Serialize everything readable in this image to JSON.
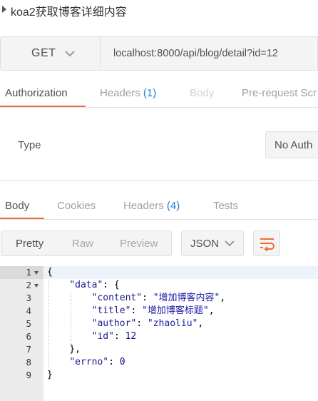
{
  "request_title": "koa2获取博客详细内容",
  "request": {
    "method": "GET",
    "url": "localhost:8000/api/blog/detail?id=12"
  },
  "request_tabs": [
    {
      "label": "Authorization",
      "count": "",
      "state": "active"
    },
    {
      "label": "Headers",
      "count": "(1)",
      "state": "normal"
    },
    {
      "label": "Body",
      "count": "",
      "state": "disabled"
    },
    {
      "label": "Pre-request Scr",
      "count": "",
      "state": "normal"
    }
  ],
  "auth": {
    "type_label": "Type",
    "type_value": "No Auth"
  },
  "response_tabs": [
    {
      "label": "Body",
      "count": "",
      "state": "active"
    },
    {
      "label": "Cookies",
      "count": "",
      "state": "normal"
    },
    {
      "label": "Headers",
      "count": "(4)",
      "state": "normal"
    },
    {
      "label": "Tests",
      "count": "",
      "state": "normal"
    }
  ],
  "view_modes": [
    "Pretty",
    "Raw",
    "Preview"
  ],
  "selected_view_mode": "Pretty",
  "format": "JSON",
  "icons": {
    "collapse": "caret-right-icon",
    "method_dropdown": "chevron-down-icon",
    "format_dropdown": "chevron-down-icon",
    "wrap": "wrap-lines-icon",
    "fold": "fold-arrow-icon"
  },
  "colors": {
    "accent": "#f26b3a",
    "count": "#1d7fd6"
  },
  "code_lines": [
    {
      "num": "1",
      "parts": [
        {
          "t": "{",
          "c": "p"
        }
      ]
    },
    {
      "num": "2",
      "parts": [
        {
          "t": "    ",
          "c": "p"
        },
        {
          "t": "\"data\"",
          "c": "k"
        },
        {
          "t": ": {",
          "c": "p"
        }
      ]
    },
    {
      "num": "3",
      "parts": [
        {
          "t": "        ",
          "c": "p"
        },
        {
          "t": "\"content\"",
          "c": "k"
        },
        {
          "t": ": ",
          "c": "p"
        },
        {
          "t": "\"增加博客内容\"",
          "c": "s"
        },
        {
          "t": ",",
          "c": "p"
        }
      ]
    },
    {
      "num": "4",
      "parts": [
        {
          "t": "        ",
          "c": "p"
        },
        {
          "t": "\"title\"",
          "c": "k"
        },
        {
          "t": ": ",
          "c": "p"
        },
        {
          "t": "\"增加博客标题\"",
          "c": "s"
        },
        {
          "t": ",",
          "c": "p"
        }
      ]
    },
    {
      "num": "5",
      "parts": [
        {
          "t": "        ",
          "c": "p"
        },
        {
          "t": "\"author\"",
          "c": "k"
        },
        {
          "t": ": ",
          "c": "p"
        },
        {
          "t": "\"zhaoliu\"",
          "c": "s"
        },
        {
          "t": ",",
          "c": "p"
        }
      ]
    },
    {
      "num": "6",
      "parts": [
        {
          "t": "        ",
          "c": "p"
        },
        {
          "t": "\"id\"",
          "c": "k"
        },
        {
          "t": ": ",
          "c": "p"
        },
        {
          "t": "12",
          "c": "n"
        }
      ]
    },
    {
      "num": "7",
      "parts": [
        {
          "t": "    },",
          "c": "p"
        }
      ]
    },
    {
      "num": "8",
      "parts": [
        {
          "t": "    ",
          "c": "p"
        },
        {
          "t": "\"errno\"",
          "c": "k"
        },
        {
          "t": ": ",
          "c": "p"
        },
        {
          "t": "0",
          "c": "n"
        }
      ]
    },
    {
      "num": "9",
      "parts": [
        {
          "t": "}",
          "c": "p"
        }
      ]
    }
  ]
}
